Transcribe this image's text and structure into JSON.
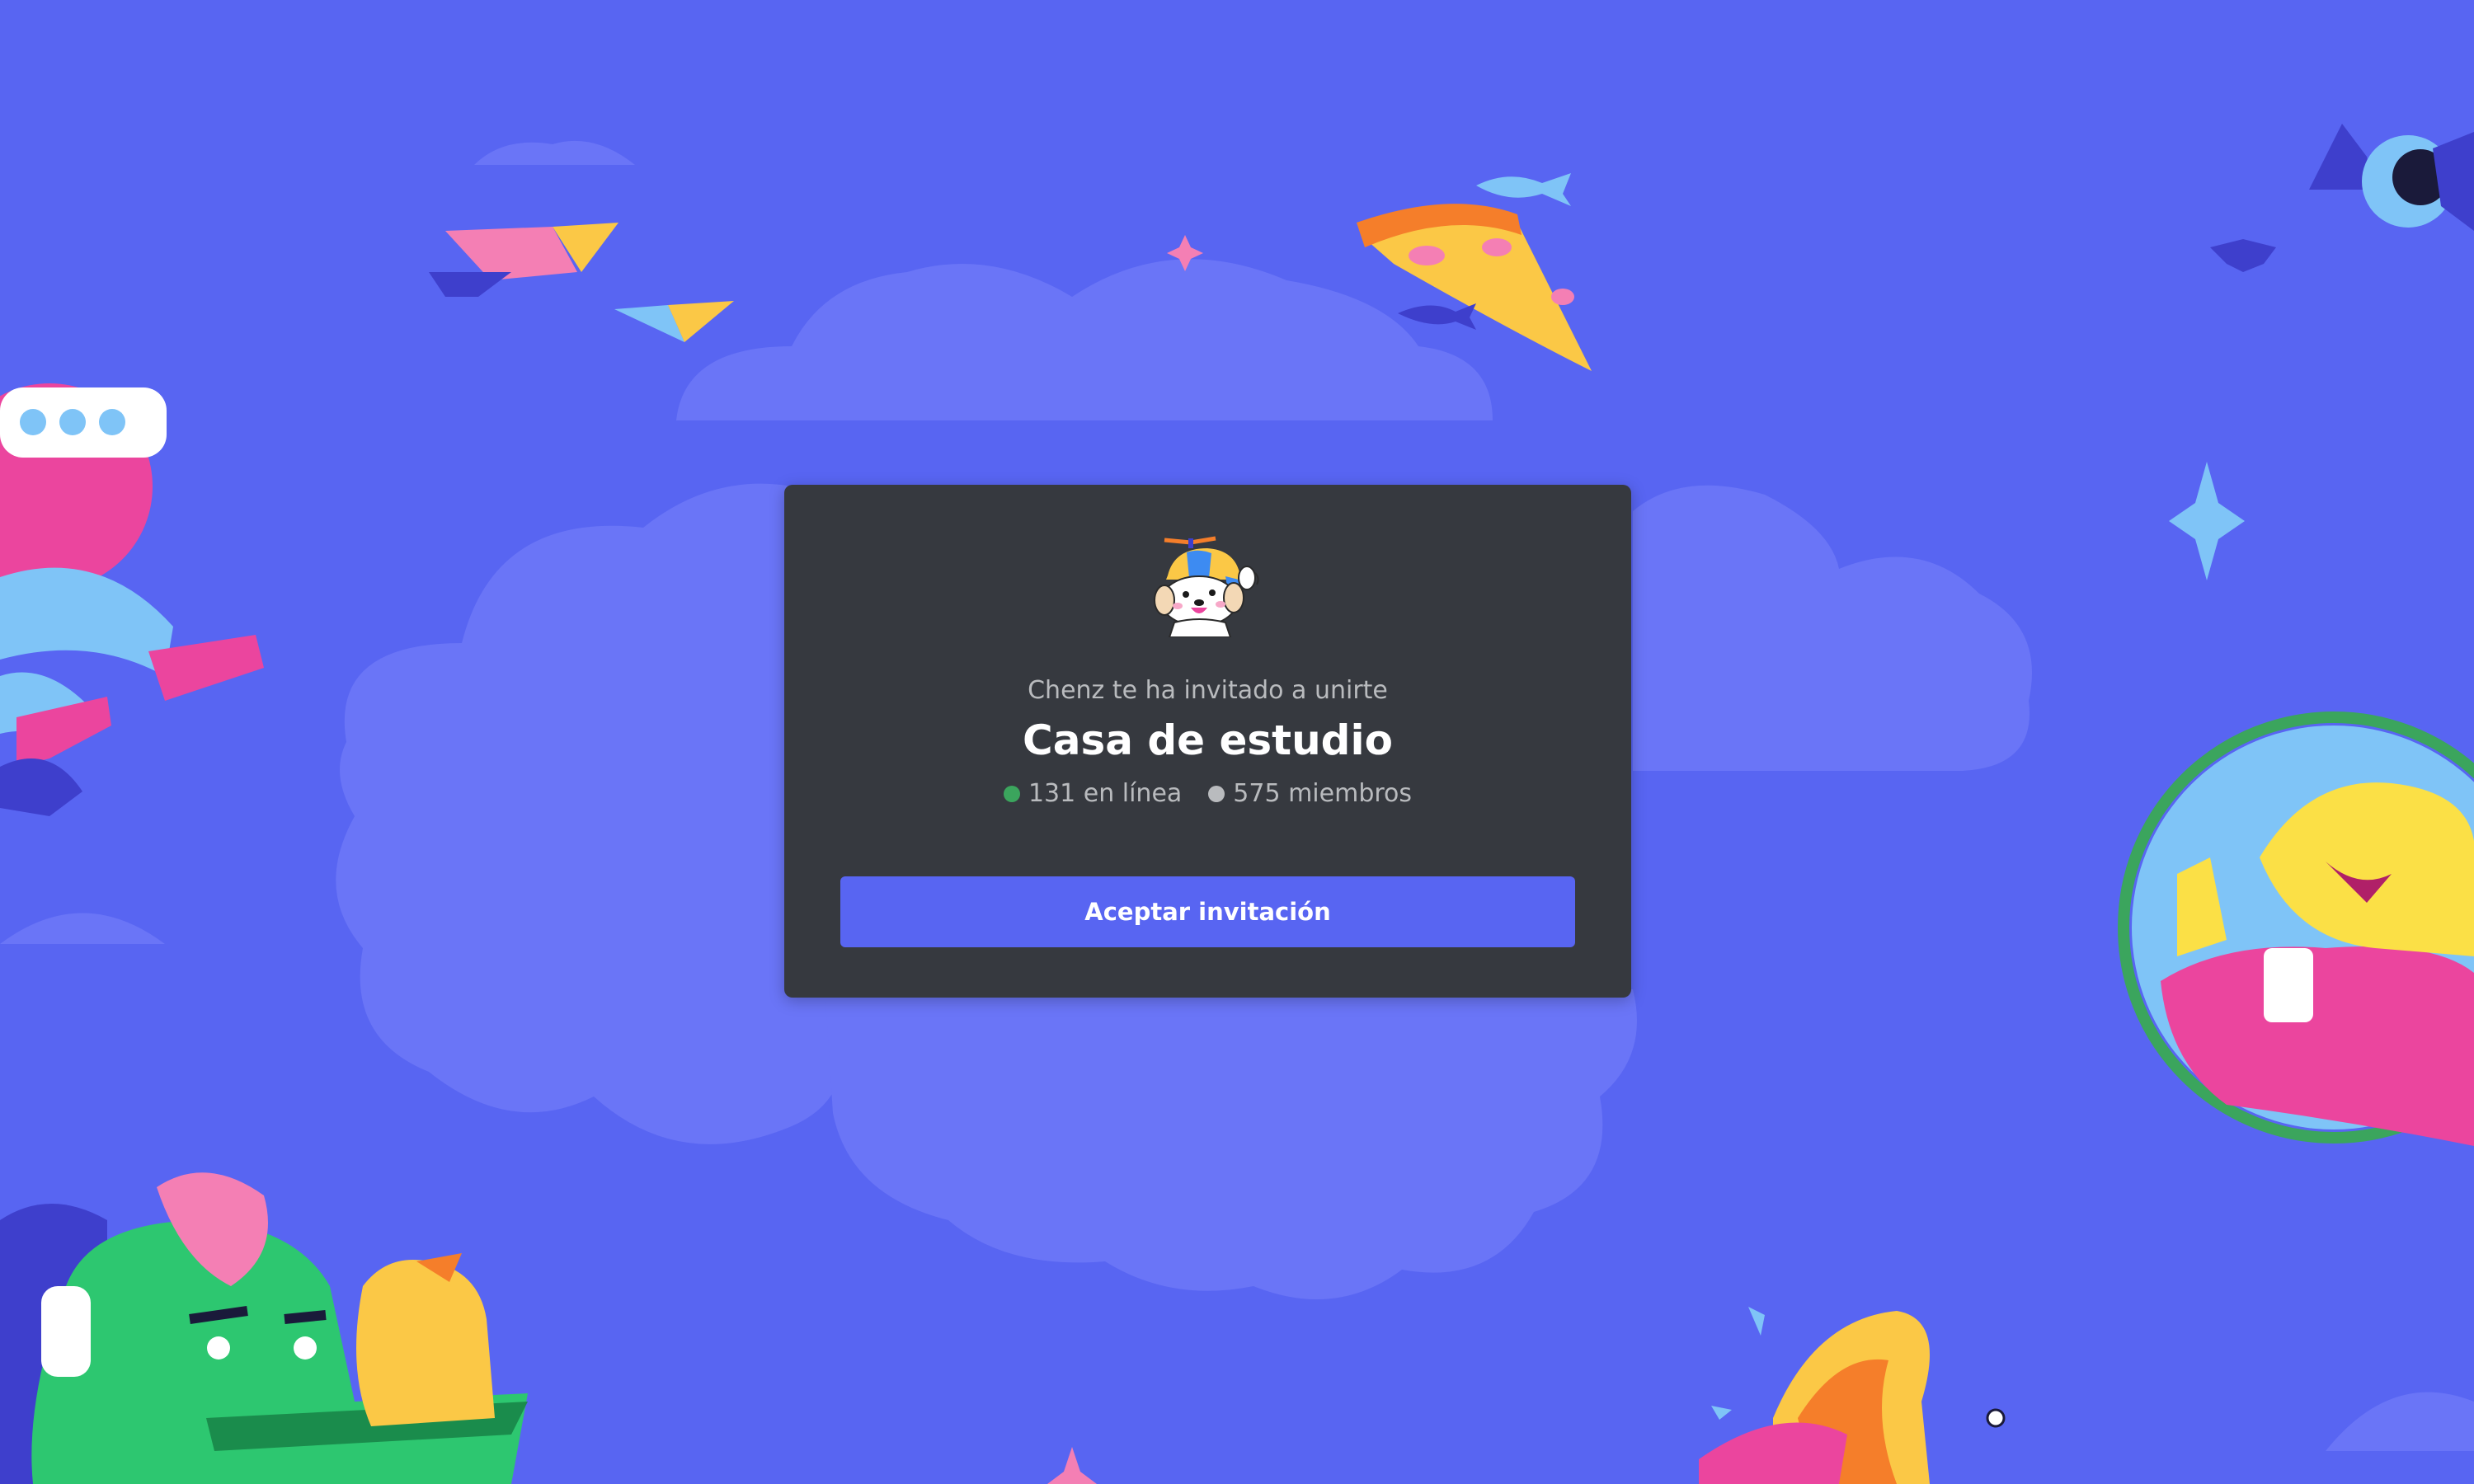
{
  "invite": {
    "inviter_text": "Chenz te ha invitado a unirte",
    "server_name": "Casa de estudio",
    "online_count": "131 en línea",
    "member_count": "575 miembros",
    "accept_label": "Aceptar invitación"
  },
  "icons": {
    "server_icon": "puppy-with-propeller-cap-icon",
    "online_indicator": "green-dot-icon",
    "members_indicator": "gray-dot-icon"
  },
  "colors": {
    "background": "#5865F2",
    "card": "#36393F",
    "accent": "#5865F2",
    "online": "#3BA55D",
    "members": "#B9BBBE"
  }
}
